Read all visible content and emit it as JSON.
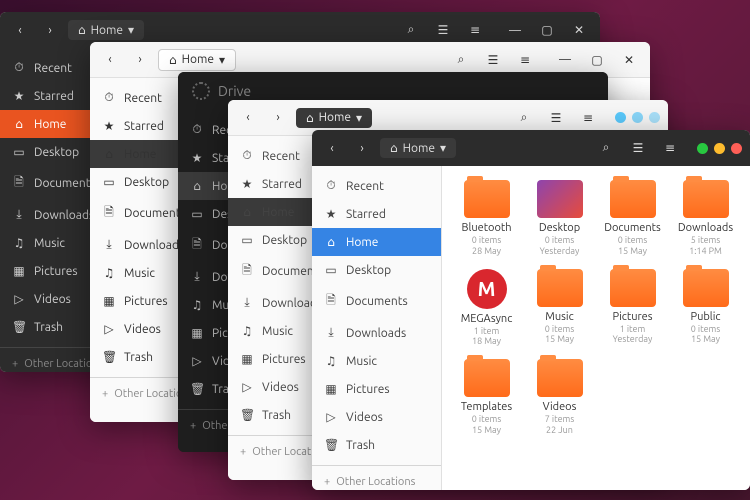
{
  "breadcrumb_label": "Home",
  "other_locations": "Other Locations",
  "drive_label": "Drive",
  "sidebar": [
    {
      "icon": "⏱",
      "label": "Recent"
    },
    {
      "icon": "★",
      "label": "Starred"
    },
    {
      "icon": "⌂",
      "label": "Home"
    },
    {
      "icon": "▭",
      "label": "Desktop"
    },
    {
      "icon": "🗎",
      "label": "Documents"
    },
    {
      "icon": "⤓",
      "label": "Downloads"
    },
    {
      "icon": "♫",
      "label": "Music"
    },
    {
      "icon": "▦",
      "label": "Pictures"
    },
    {
      "icon": "▷",
      "label": "Videos"
    },
    {
      "icon": "🗑",
      "label": "Trash"
    }
  ],
  "files": [
    {
      "name": "Bluetooth",
      "meta1": "0 items",
      "meta2": "28 May",
      "kind": "folder"
    },
    {
      "name": "Desktop",
      "meta1": "0 items",
      "meta2": "Yesterday",
      "kind": "desktop"
    },
    {
      "name": "Documents",
      "meta1": "0 items",
      "meta2": "15 May",
      "kind": "folder"
    },
    {
      "name": "Downloads",
      "meta1": "5 items",
      "meta2": "1:14 PM",
      "kind": "folder"
    },
    {
      "name": "MEGAsync",
      "meta1": "1 item",
      "meta2": "18 May",
      "kind": "mega"
    },
    {
      "name": "Music",
      "meta1": "0 items",
      "meta2": "15 May",
      "kind": "folder"
    },
    {
      "name": "Pictures",
      "meta1": "1 item",
      "meta2": "Yesterday",
      "kind": "folder"
    },
    {
      "name": "Public",
      "meta1": "0 items",
      "meta2": "15 May",
      "kind": "folder"
    },
    {
      "name": "Templates",
      "meta1": "0 items",
      "meta2": "15 May",
      "kind": "folder"
    },
    {
      "name": "Videos",
      "meta1": "7 items",
      "meta2": "22 Jun",
      "kind": "folder"
    }
  ]
}
